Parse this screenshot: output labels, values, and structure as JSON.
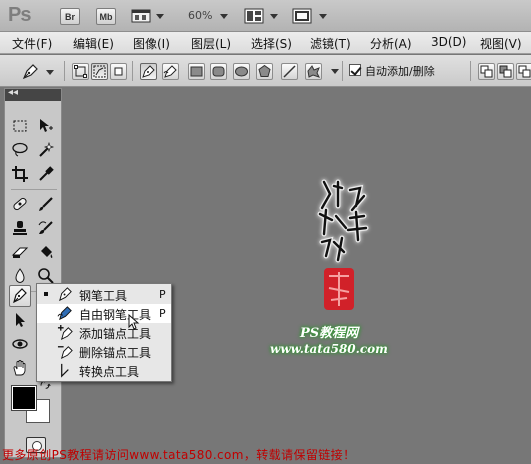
{
  "app": {
    "logo": "Ps"
  },
  "appbar": {
    "bridge_label": "Br",
    "minibridge_label": "Mb",
    "zoom": "60%"
  },
  "menu": [
    "文件(F)",
    "编辑(E)",
    "图像(I)",
    "图层(L)",
    "选择(S)",
    "滤镜(T)",
    "分析(A)",
    "3D(D)",
    "视图(V)"
  ],
  "options": {
    "auto_add_delete_label": "自动添加/删除",
    "auto_add_delete_checked": true
  },
  "toolbar": {
    "collapse_glyph": "◂◂"
  },
  "flyout": [
    {
      "label": "钢笔工具",
      "key": "P",
      "current": true,
      "icon": "pen-icon"
    },
    {
      "label": "自由钢笔工具",
      "key": "P",
      "current": false,
      "icon": "freeform-pen-icon"
    },
    {
      "label": "添加锚点工具",
      "key": "",
      "current": false,
      "icon": "add-anchor-icon"
    },
    {
      "label": "删除锚点工具",
      "key": "",
      "current": false,
      "icon": "delete-anchor-icon"
    },
    {
      "label": "转换点工具",
      "key": "",
      "current": false,
      "icon": "convert-point-icon"
    }
  ],
  "canvas": {
    "site_name": "PS教程网",
    "site_url": "www.tata580.com",
    "footer_text": "更多原创PS教程请访问www.tata580.com，转载请保留链接！"
  },
  "colors": {
    "canvas_bg": "#777777",
    "accent_glow": "#2d9a2d",
    "footer_red": "#c00000",
    "seal_red": "#e0121b"
  }
}
